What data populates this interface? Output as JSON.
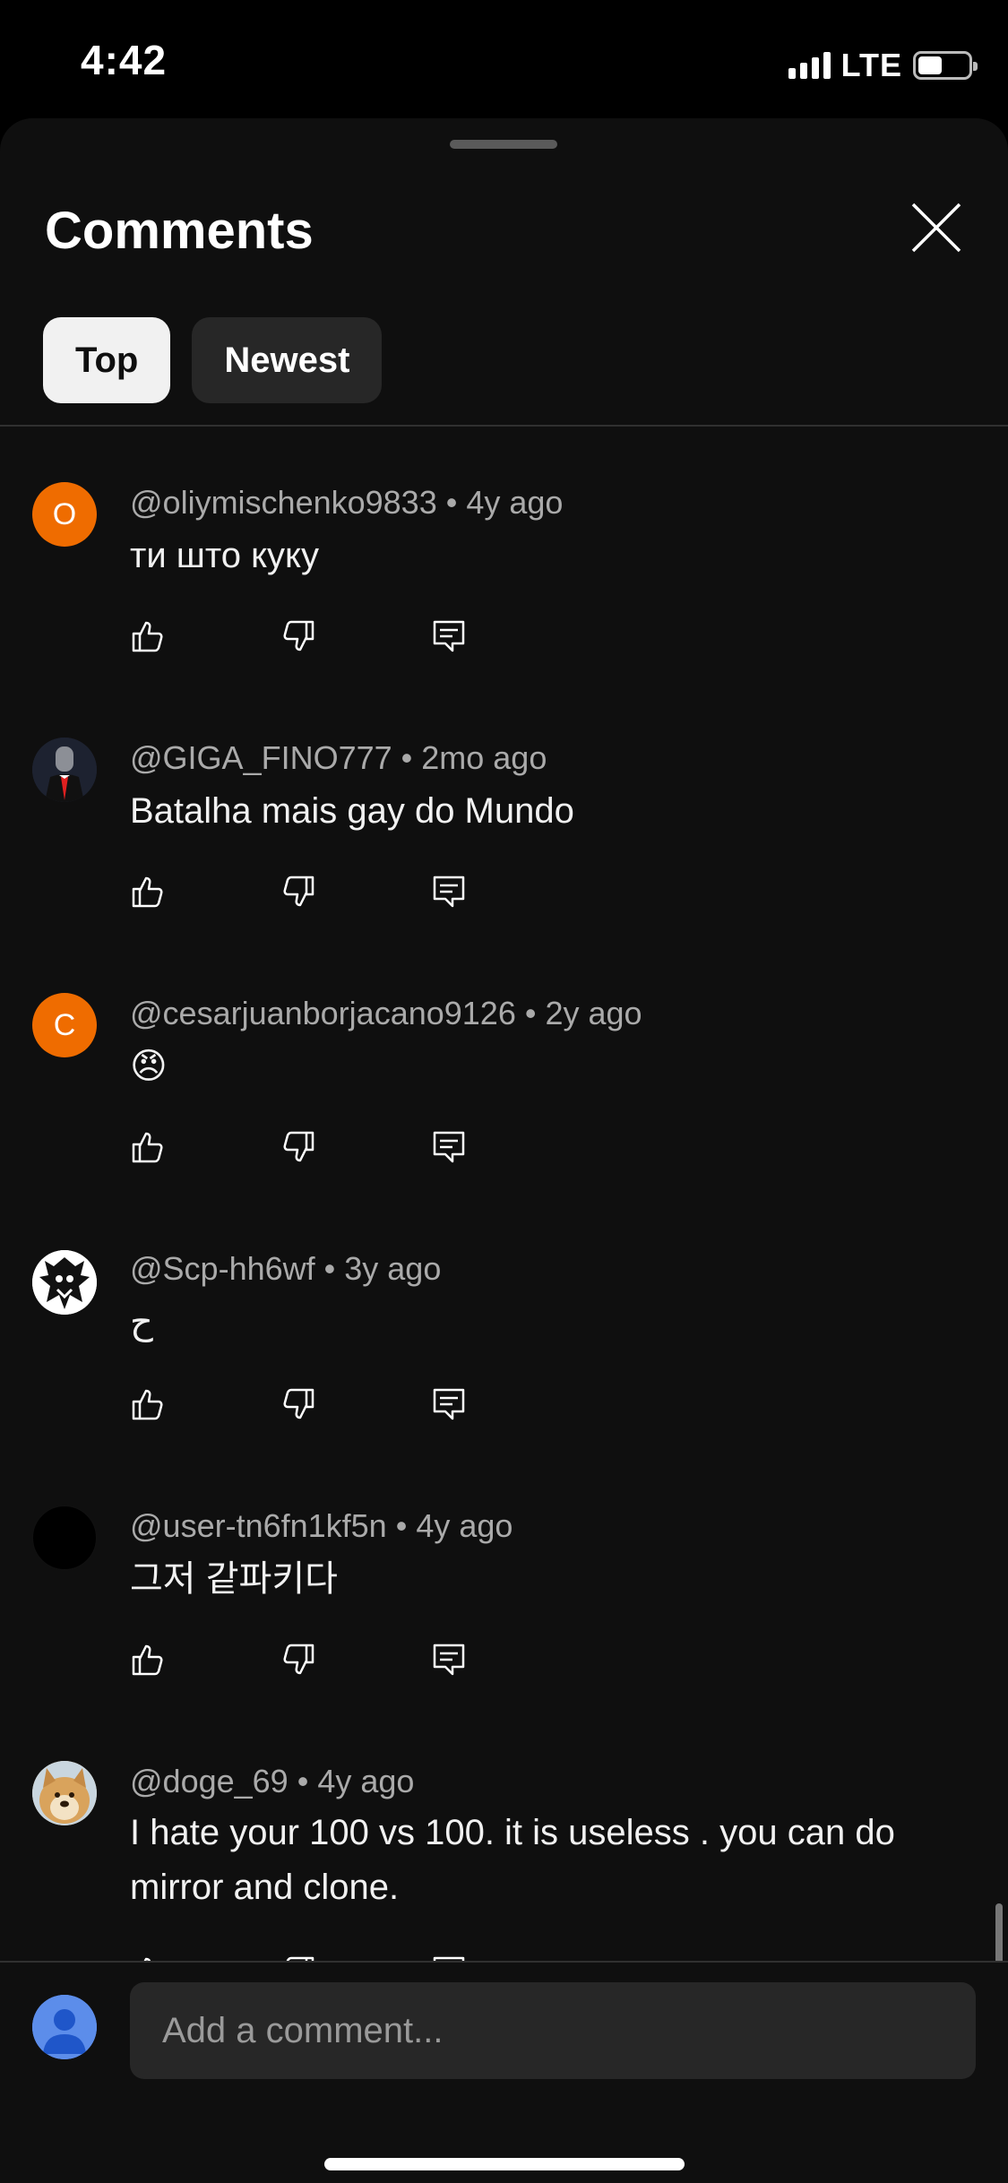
{
  "status": {
    "time": "4:42",
    "network": "LTE"
  },
  "header": {
    "title": "Comments"
  },
  "tabs": [
    {
      "label": "Top",
      "active": true
    },
    {
      "label": "Newest",
      "active": false
    }
  ],
  "comments": [
    {
      "author": "@oliymischenko9833",
      "age": "4y ago",
      "text": "ти што куку",
      "avatar_letter": "O",
      "avatar_color": "#ef6c00"
    },
    {
      "author": "@GIGA_FINO777",
      "age": "2mo ago",
      "text": "Batalha mais gay do Mundo",
      "avatar_letter": "",
      "avatar_color": "#1d2230"
    },
    {
      "author": "@cesarjuanborjacano9126",
      "age": "2y ago",
      "text": "😠",
      "avatar_letter": "C",
      "avatar_color": "#ef6c00"
    },
    {
      "author": "@Scp-hh6wf",
      "age": "3y ago",
      "text": "ح",
      "avatar_letter": "",
      "avatar_color": "#ffffff"
    },
    {
      "author": "@user-tn6fn1kf5n",
      "age": "4y ago",
      "text": "그저 같파키다",
      "avatar_letter": "",
      "avatar_color": "#000000"
    },
    {
      "author": "@doge_69",
      "age": "4y ago",
      "text": "I hate your 100 vs 100. it is useless . you can do mirror and clone.",
      "avatar_letter": "",
      "avatar_color": "#d9b07a"
    }
  ],
  "composer": {
    "placeholder": "Add a comment..."
  }
}
